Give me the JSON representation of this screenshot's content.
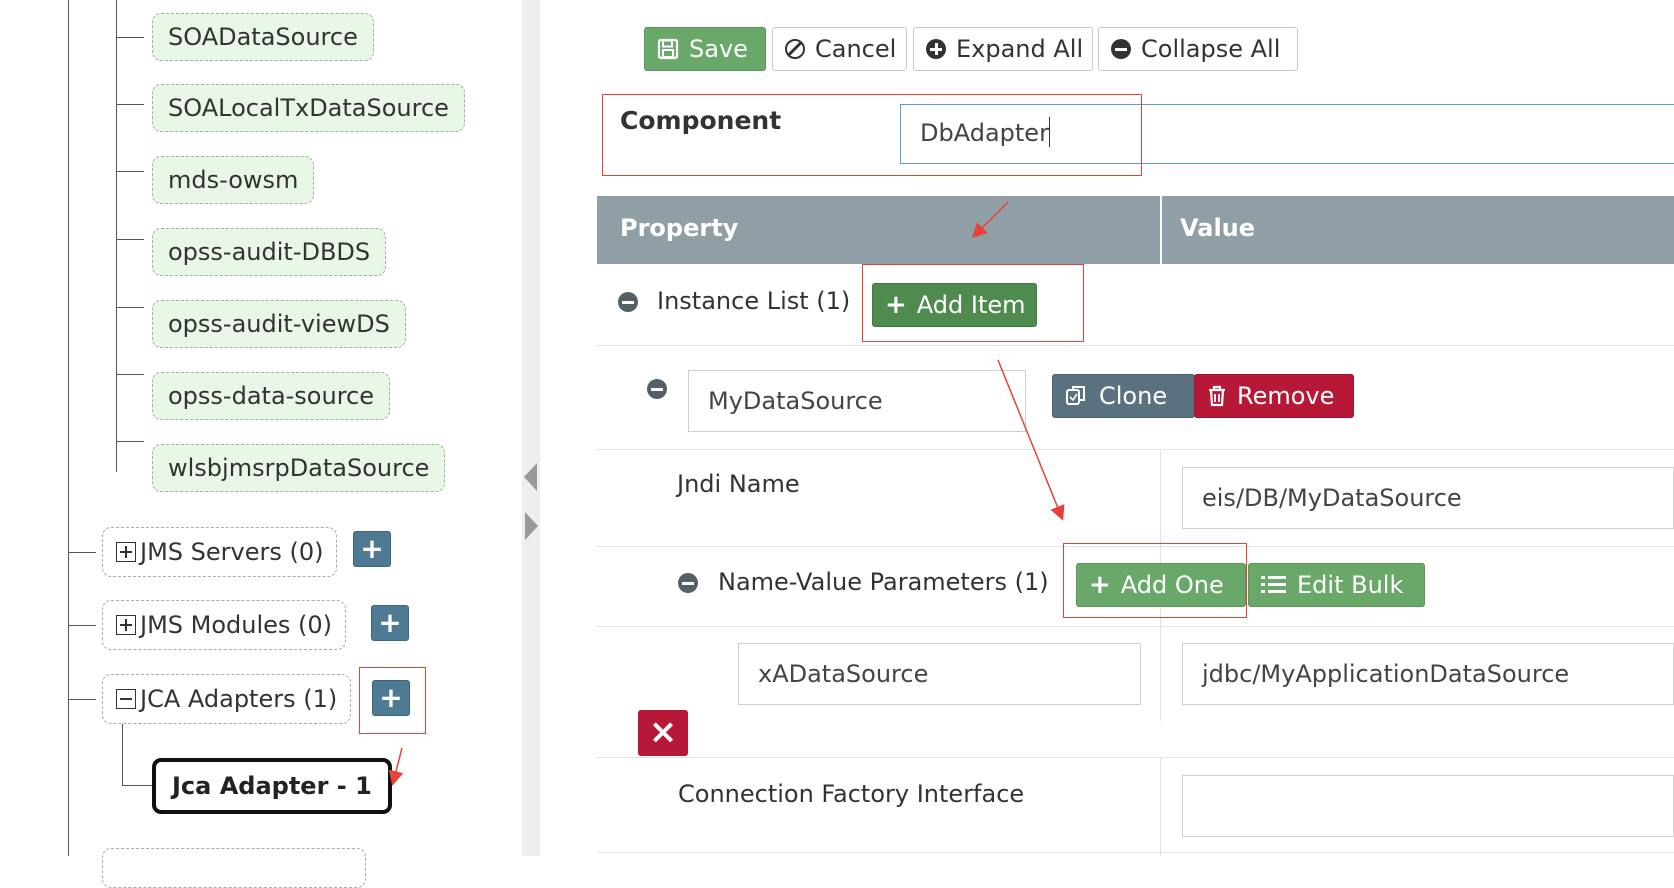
{
  "tree": {
    "datasources": [
      "SOADataSource",
      "SOALocalTxDataSource",
      "mds-owsm",
      "opss-audit-DBDS",
      "opss-audit-viewDS",
      "opss-data-source",
      "wlsbjmsrpDataSource"
    ],
    "groups": [
      {
        "label": "JMS Servers (0)",
        "state": "collapsed"
      },
      {
        "label": "JMS Modules (0)",
        "state": "collapsed"
      },
      {
        "label": "JCA Adapters (1)",
        "state": "expanded"
      }
    ],
    "add_button": "+",
    "selected_node": "Jca Adapter - 1"
  },
  "toolbar": {
    "save": "Save",
    "cancel": "Cancel",
    "expand_all": "Expand All",
    "collapse_all": "Collapse All"
  },
  "component": {
    "label": "Component",
    "value": "DbAdapter"
  },
  "table": {
    "col_property": "Property",
    "col_value": "Value"
  },
  "instance_list": {
    "label": "Instance List (1)",
    "add_item": "Add Item"
  },
  "instance": {
    "name": "MyDataSource",
    "clone": "Clone",
    "remove": "Remove"
  },
  "jndi": {
    "label": "Jndi Name",
    "value": "eis/DB/MyDataSource"
  },
  "nv_params": {
    "label": "Name-Value Parameters (1)",
    "add_one": "Add One",
    "edit_bulk": "Edit Bulk",
    "param_name": "xADataSource",
    "param_value": "jdbc/MyApplicationDataSource",
    "delete": "×"
  },
  "cfi": {
    "label": "Connection Factory Interface",
    "value": ""
  },
  "colors": {
    "header_bg": "#909fa6",
    "annotation_red": "#e8413a",
    "save_green": "#6aa86a",
    "add_green": "#4f8a4f",
    "remove_red": "#b81838"
  }
}
